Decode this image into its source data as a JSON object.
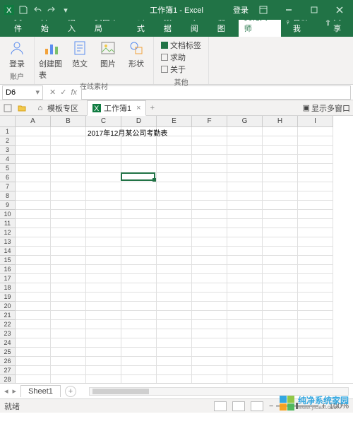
{
  "title": "工作簿1 - Excel",
  "login_text": "登录",
  "ribbon": {
    "tabs": [
      "文件",
      "开始",
      "插入",
      "页面布局",
      "公式",
      "数据",
      "审阅",
      "视图",
      "美化大师"
    ],
    "active_index": 8,
    "tellme": "告诉我",
    "share": "共享"
  },
  "groups": {
    "account": {
      "label": "账户",
      "btn1": "登录"
    },
    "gallery": {
      "label": "在线素材",
      "btn1": "创建图表",
      "btn2": "范文",
      "btn3": "图片",
      "btn4": "形状"
    },
    "other": {
      "label": "其他",
      "opt1": "文档标签",
      "opt2": "求助",
      "opt3": "关于"
    }
  },
  "namebox": "D6",
  "doc_tabs": {
    "t1": "模板专区",
    "t2": "工作簿1"
  },
  "show_more": "显示多窗口",
  "columns": [
    "A",
    "B",
    "C",
    "D",
    "E",
    "F",
    "G",
    "H",
    "I"
  ],
  "row_count": 28,
  "cell_text": "2017年12月某公司考勤表",
  "selected_cell": {
    "col": 3,
    "row": 5
  },
  "sheet": "Sheet1",
  "status": "就绪",
  "zoom": "100%",
  "watermark": {
    "line1": "纯净系统家园",
    "line2": "www.yidaxi.com"
  }
}
